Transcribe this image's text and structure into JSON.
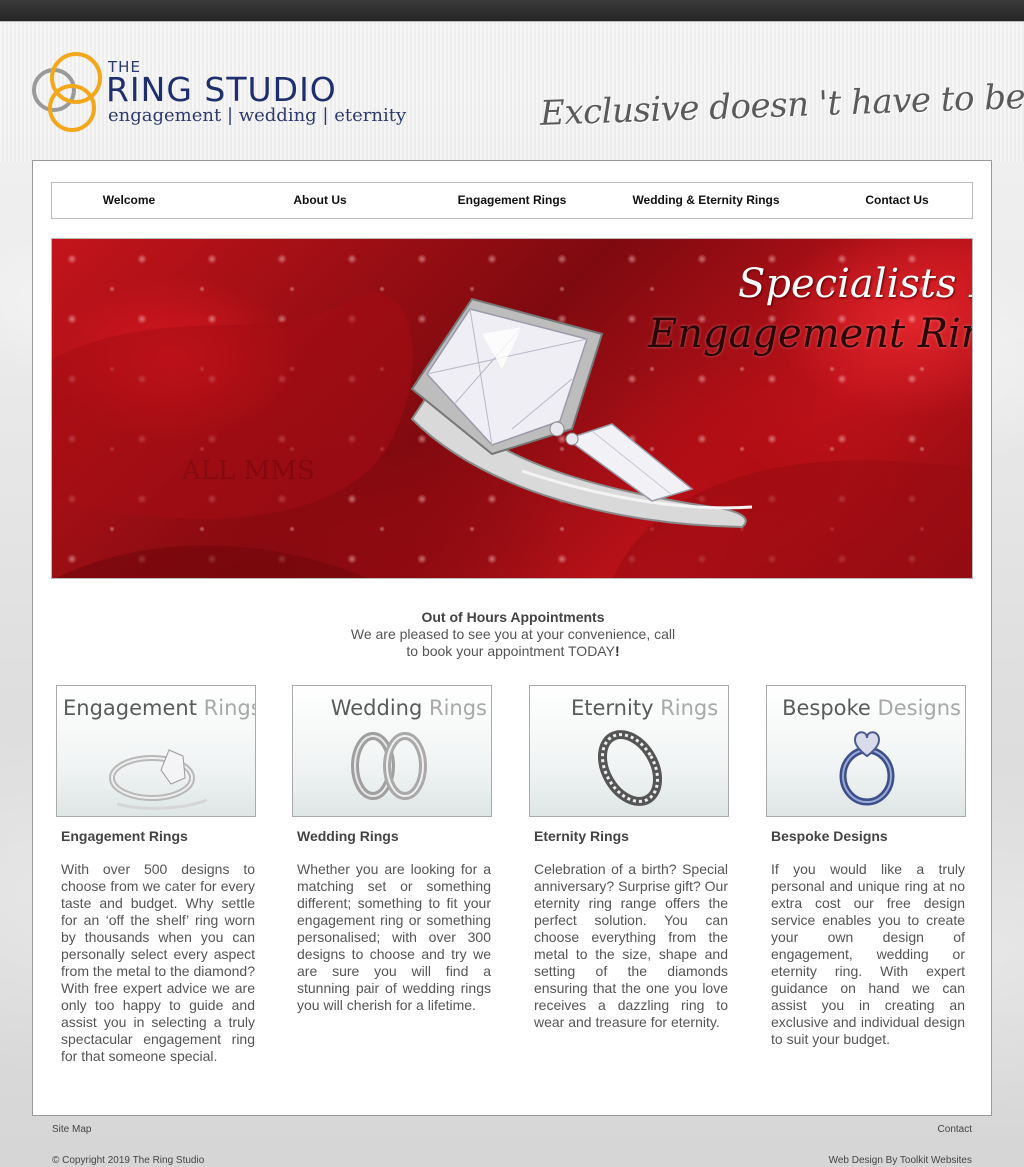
{
  "header": {
    "logo_the": "THE",
    "logo_name": "RING STUDIO",
    "logo_tagline": "engagement | wedding | eternity",
    "slogan": "Exclusive doesn 't have to be expensive!"
  },
  "nav": {
    "items": [
      {
        "label": "Welcome"
      },
      {
        "label": "About Us"
      },
      {
        "label": "Engagement Rings"
      },
      {
        "label": "Wedding & Eternity Rings"
      },
      {
        "label": "Contact Us"
      }
    ]
  },
  "hero": {
    "line1": "Specialists In",
    "line2": "Engagement Rings"
  },
  "appointments": {
    "title": "Out of Hours Appointments",
    "line1": "We are pleased to see you at your convenience, call",
    "line2": "to book your appointment TODAY",
    "bang": "!"
  },
  "columns": [
    {
      "card_word1": "Engagement",
      "card_word2": "Rings",
      "title": "Engagement Rings",
      "text": "With over 500 designs to choose from we cater for every taste and budget.  Why settle for an ‘off the shelf’ ring worn by thousands when you can personally select every aspect from the metal to the diamond? With free expert advice we are only too happy to guide and assist you in selecting a truly spectacular engagement ring for that someone special."
    },
    {
      "card_word1": "Wedding",
      "card_word2": "Rings",
      "title": "Wedding Rings",
      "text": "Whether you are looking for a matching set or something different; something to fit your engagement ring or something personalised; with over 300 designs to choose and try we are sure you will find a stunning pair of wedding rings you will cherish for a lifetime."
    },
    {
      "card_word1": "Eternity",
      "card_word2": "Rings",
      "title": "Eternity Rings",
      "text": "Celebration of a birth? Special anniversary? Surprise gift? Our eternity ring range offers the perfect solution. You can choose everything from the metal to the size, shape and setting of the diamonds ensuring that the one you love receives a dazzling ring to wear and treasure for eternity."
    },
    {
      "card_word1": "Bespoke",
      "card_word2": "Designs",
      "title": "Bespoke Designs",
      "text": "If you would like a truly personal and unique ring at no extra cost our free design service enables you to create your own design of engagement, wedding or eternity ring. With expert guidance on hand we can assist you in creating an exclusive and individual design to suit your budget."
    }
  ],
  "footer": {
    "sitemap": "Site Map",
    "contact": "Contact",
    "copyright": "© Copyright 2019 The Ring Studio",
    "credit": "Web Design By Toolkit Websites"
  }
}
